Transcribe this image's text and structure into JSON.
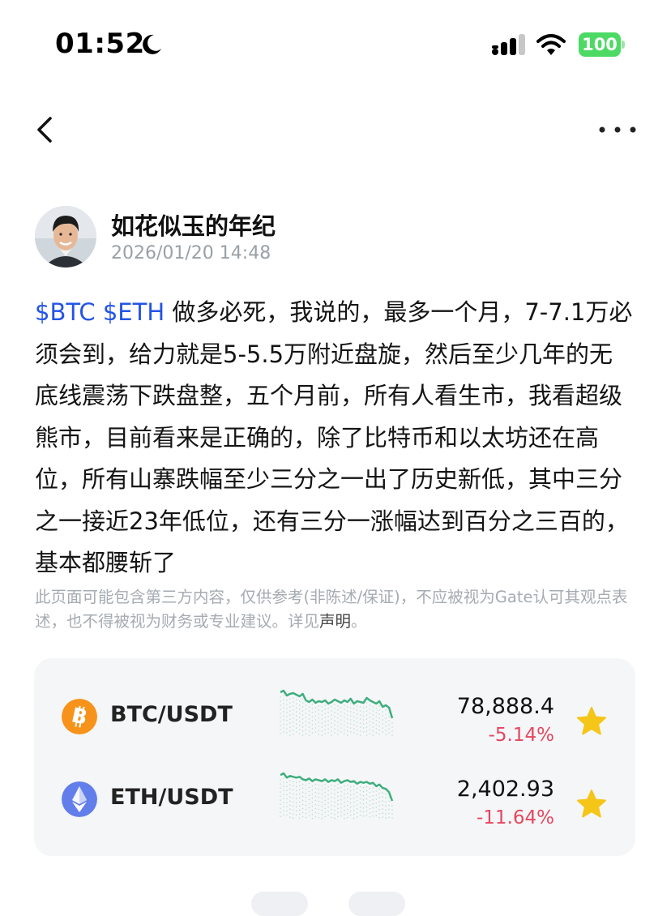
{
  "status_bar": {
    "time": "01:52",
    "battery": "100",
    "battery_color": "#4cd964"
  },
  "nav": {
    "back_icon": "chevron-left-icon",
    "more_icon": "ellipsis-icon"
  },
  "post": {
    "author": "如花似玉的年纪",
    "time": "2026/01/20 14:48",
    "tags": [
      "$BTC",
      "$ETH"
    ],
    "body": "做多必死，我说的，最多一个月，7-7.1万必须会到，给力就是5-5.5万附近盘旋，然后至少几年的无底线震荡下跌盘整，五个月前，所有人看生市，我看超级熊市，目前看来是正确的，除了比特币和以太坊还在高位，所有山寨跌幅至少三分之一出了历史新低，其中三分之一接近23年低位，还有三分一涨幅达到百分之三百的，基本都腰斩了",
    "tag_color": "#2354e6"
  },
  "disclaimer": {
    "text": "此页面可能包含第三方内容，仅供参考(非陈述/保证)，不应被视为Gate认可其观点表述，也不得被视为财务或专业建议。详见",
    "link": "声明",
    "end": "。"
  },
  "tickers": [
    {
      "pair": "BTC/USDT",
      "price": "78,888.4",
      "change": "-5.14%",
      "icon": "bitcoin-icon",
      "icon_color": "#f7931a",
      "spark": [
        62,
        64,
        58,
        60,
        61,
        59,
        57,
        60,
        52,
        50,
        53,
        49,
        51,
        50,
        52,
        48,
        50,
        53,
        51,
        49,
        52,
        50,
        54,
        48,
        51,
        50,
        49,
        55,
        52,
        50,
        48,
        51,
        44,
        46,
        43,
        30
      ]
    },
    {
      "pair": "ETH/USDT",
      "price": "2,402.93",
      "change": "-11.64%",
      "icon": "ethereum-icon",
      "icon_color": "#627eea",
      "spark": [
        60,
        62,
        57,
        59,
        58,
        57,
        58,
        55,
        54,
        56,
        53,
        55,
        54,
        53,
        55,
        52,
        54,
        53,
        55,
        51,
        53,
        54,
        52,
        53,
        50,
        52,
        51,
        52,
        50,
        51,
        47,
        49,
        45,
        44,
        40,
        30
      ]
    }
  ],
  "colors": {
    "spark_line": "#3fae7f",
    "negative": "#e5475f",
    "star": "#f5c518"
  }
}
